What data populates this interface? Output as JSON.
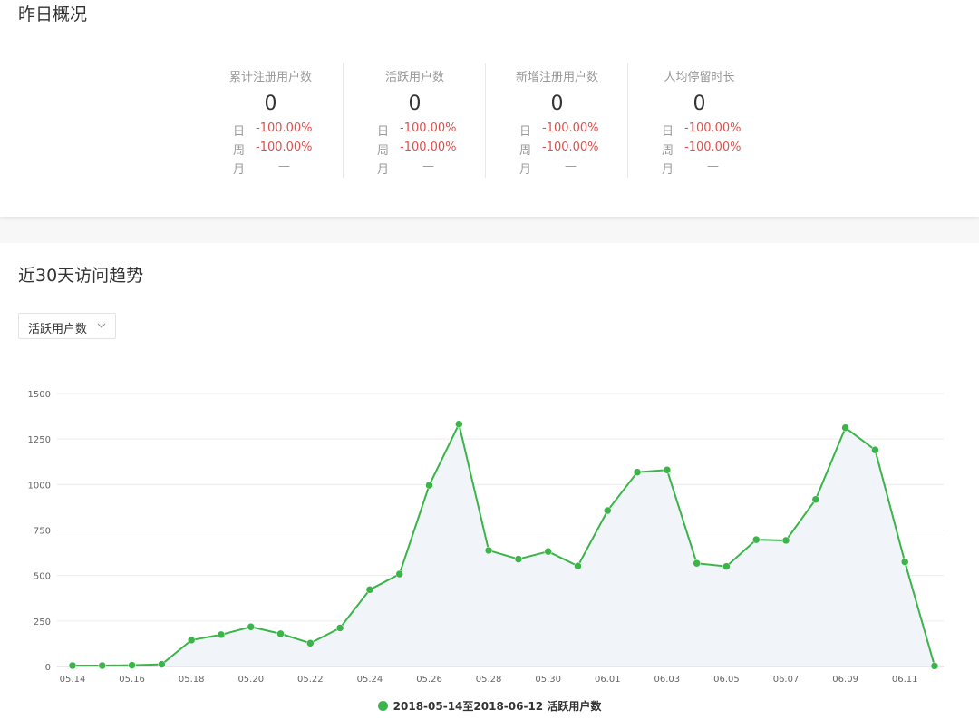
{
  "overview": {
    "title": "昨日概况",
    "stats": [
      {
        "label": "累计注册用户数",
        "value": "0",
        "rows": [
          {
            "k": "日",
            "v": "-100.00%"
          },
          {
            "k": "周",
            "v": "-100.00%"
          },
          {
            "k": "月",
            "v": "—"
          }
        ]
      },
      {
        "label": "活跃用户数",
        "value": "0",
        "rows": [
          {
            "k": "日",
            "v": "-100.00%"
          },
          {
            "k": "周",
            "v": "-100.00%"
          },
          {
            "k": "月",
            "v": "—"
          }
        ]
      },
      {
        "label": "新增注册用户数",
        "value": "0",
        "rows": [
          {
            "k": "日",
            "v": "-100.00%"
          },
          {
            "k": "周",
            "v": "-100.00%"
          },
          {
            "k": "月",
            "v": "—"
          }
        ]
      },
      {
        "label": "人均停留时长",
        "value": "0",
        "rows": [
          {
            "k": "日",
            "v": "-100.00%"
          },
          {
            "k": "周",
            "v": "-100.00%"
          },
          {
            "k": "月",
            "v": "—"
          }
        ]
      }
    ]
  },
  "trend": {
    "title": "近30天访问趋势",
    "dropdown": {
      "selected": "活跃用户数",
      "icon": "chevron-down-icon"
    }
  },
  "colors": {
    "line": "#3bb449",
    "area": "#f1f4f9",
    "negative": "#e0504c"
  },
  "chart_data": {
    "type": "line",
    "x": [
      "05.14",
      "05.15",
      "05.16",
      "05.17",
      "05.18",
      "05.19",
      "05.20",
      "05.21",
      "05.22",
      "05.23",
      "05.24",
      "05.25",
      "05.26",
      "05.27",
      "05.28",
      "05.29",
      "05.30",
      "05.31",
      "06.01",
      "06.02",
      "06.03",
      "06.04",
      "06.05",
      "06.06",
      "06.07",
      "06.08",
      "06.09",
      "06.10",
      "06.11",
      "06.12"
    ],
    "x_tick_labels": [
      "05.14",
      "05.16",
      "05.18",
      "05.20",
      "05.22",
      "05.24",
      "05.26",
      "05.28",
      "05.30",
      "06.01",
      "06.03",
      "06.05",
      "06.07",
      "06.09",
      "06.11"
    ],
    "series": [
      {
        "name": "2018-05-14至2018-06-12 活跃用户数",
        "values": [
          5,
          5,
          7,
          12,
          145,
          175,
          218,
          180,
          128,
          212,
          422,
          508,
          996,
          1332,
          638,
          590,
          632,
          552,
          857,
          1068,
          1080,
          567,
          550,
          697,
          693,
          918,
          1312,
          1190,
          575,
          3
        ]
      }
    ],
    "ylim": [
      0,
      1500
    ],
    "yticks": [
      0,
      250,
      500,
      750,
      1000,
      1250,
      1500
    ],
    "grid": true,
    "area_fill": true,
    "legend_position": "bottom-center"
  }
}
